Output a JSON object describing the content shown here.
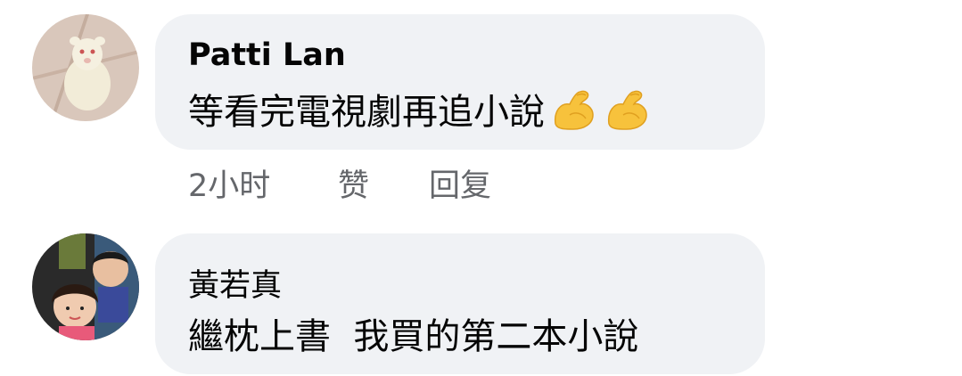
{
  "comments": [
    {
      "author": "Patti Lan",
      "text": "等看完電視劇再追小說",
      "emoji": [
        "flexed-biceps-emoji",
        "flexed-biceps-emoji"
      ],
      "actions": {
        "time": "2小时",
        "like": "赞",
        "reply": "回复"
      }
    },
    {
      "author": "黃若真",
      "text": "繼枕上書  我買的第二本小說"
    }
  ],
  "colors": {
    "bubble_bg": "#f0f2f5",
    "text": "#050505",
    "meta": "#65676b"
  }
}
